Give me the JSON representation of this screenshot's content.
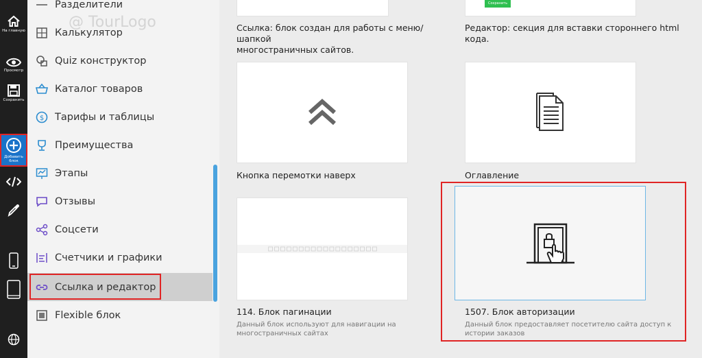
{
  "toolbar": {
    "home_label": "На главную",
    "preview_label": "Просмотр",
    "save_label": "Сохранить",
    "add_block_label_1": "Добавить",
    "add_block_label_2": "блок"
  },
  "sidebar": {
    "items": [
      {
        "label": "Разделители",
        "icon": "divider-icon"
      },
      {
        "label": "Калькулятор",
        "icon": "calculator-icon"
      },
      {
        "label": "Quiz конструктор",
        "icon": "quiz-icon"
      },
      {
        "label": "Каталог товаров",
        "icon": "basket-icon"
      },
      {
        "label": "Тарифы и таблицы",
        "icon": "dollar-icon"
      },
      {
        "label": "Преимущества",
        "icon": "trophy-icon"
      },
      {
        "label": "Этапы",
        "icon": "chart-board-icon"
      },
      {
        "label": "Отзывы",
        "icon": "chat-icon"
      },
      {
        "label": "Соцсети",
        "icon": "share-icon"
      },
      {
        "label": "Счетчики и графики",
        "icon": "counter-icon"
      },
      {
        "label": "Ссылка и редактор",
        "icon": "link-icon"
      },
      {
        "label": "Flexible блок",
        "icon": "flexible-icon"
      }
    ],
    "selected_index": 10
  },
  "background": {
    "watermark_brand": "@ TourLogo"
  },
  "cards": {
    "link_block": {
      "title_1": "Ссылка: блок создан для работы с меню/шапкой",
      "title_2": "многостраничных сайтов."
    },
    "editor_block": {
      "title_1": "Редактор: секция для вставки стороннего html",
      "title_2": "кода.",
      "button_label": "Сохранить"
    },
    "scroll_top": {
      "title": "Кнопка перемотки наверх"
    },
    "toc": {
      "title": "Оглавление"
    },
    "pagination": {
      "title": "114. Блок пагинации",
      "desc_1": "Данный блок используют для навигации на",
      "desc_2": "многостраничных сайтах"
    },
    "auth": {
      "title": "1507. Блок авторизации",
      "desc_1": "Данный блок предоставляет посетителю сайта доступ к",
      "desc_2": "истории заказов"
    }
  },
  "colors": {
    "toolbar_bg": "#1f1f1f",
    "active_blue": "#1a73c9",
    "highlight_red": "#e02424",
    "icon_purple": "#6b4bc7",
    "icon_blue": "#2b8ccf",
    "scrollbar": "#4aa3df"
  }
}
